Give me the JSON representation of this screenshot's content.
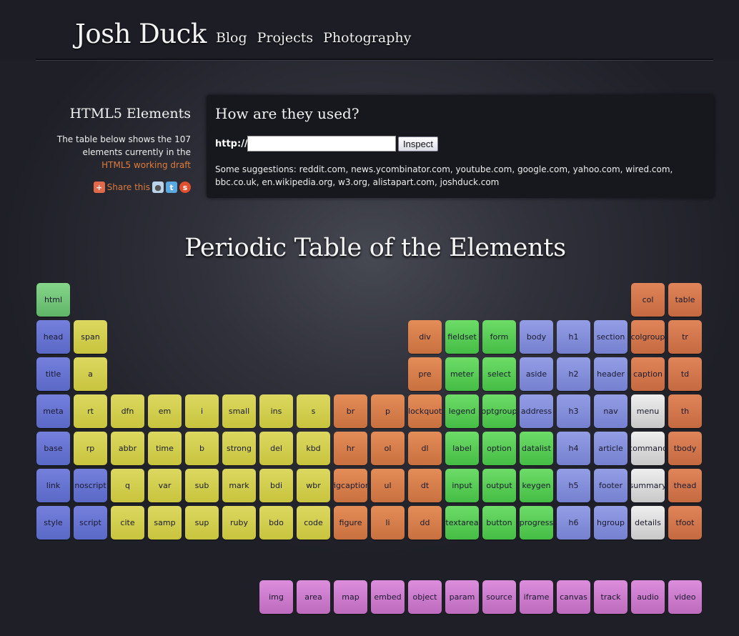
{
  "header": {
    "site_title": "Josh Duck",
    "nav": [
      "Blog",
      "Projects",
      "Photography"
    ]
  },
  "sidebar": {
    "title": "HTML5 Elements",
    "description": "The table below shows the 107 elements currently in the",
    "draft_link": "HTML5 working draft",
    "share_label": "Share this",
    "share_icons": [
      "share-plus-icon",
      "reddit-icon",
      "twitter-icon",
      "stumbleupon-icon"
    ]
  },
  "inspect": {
    "heading": "How are they used?",
    "prefix": "http://",
    "input_value": "",
    "button_label": "Inspect",
    "suggestions": "Some suggestions: reddit.com, news.ycombinator.com, youtube.com, google.com, yahoo.com, wired.com, bbc.co.uk, en.wikipedia.org, w3.org, alistapart.com, joshduck.com"
  },
  "table_title": "Periodic Table of the Elements",
  "colors": {
    "root": "#73c57a",
    "metadata": "#6874d2",
    "text_level": "#d2ce50",
    "grouping": "#d87e4c",
    "forms": "#59cd57",
    "sections": "#858fdb",
    "interactive": "#dcdcdc",
    "tables": "#d47a4e",
    "embedded": "#cd7ccd"
  },
  "elements": [
    {
      "name": "html",
      "col": 0,
      "row": 0,
      "cat": "root"
    },
    {
      "name": "head",
      "col": 0,
      "row": 1,
      "cat": "meta"
    },
    {
      "name": "title",
      "col": 0,
      "row": 2,
      "cat": "meta"
    },
    {
      "name": "meta",
      "col": 0,
      "row": 3,
      "cat": "meta"
    },
    {
      "name": "base",
      "col": 0,
      "row": 4,
      "cat": "meta"
    },
    {
      "name": "link",
      "col": 0,
      "row": 5,
      "cat": "meta"
    },
    {
      "name": "style",
      "col": 0,
      "row": 6,
      "cat": "meta"
    },
    {
      "name": "span",
      "col": 1,
      "row": 1,
      "cat": "text"
    },
    {
      "name": "a",
      "col": 1,
      "row": 2,
      "cat": "text"
    },
    {
      "name": "rt",
      "col": 1,
      "row": 3,
      "cat": "text"
    },
    {
      "name": "rp",
      "col": 1,
      "row": 4,
      "cat": "text"
    },
    {
      "name": "noscript",
      "col": 1,
      "row": 5,
      "cat": "meta"
    },
    {
      "name": "script",
      "col": 1,
      "row": 6,
      "cat": "meta"
    },
    {
      "name": "dfn",
      "col": 2,
      "row": 3,
      "cat": "text"
    },
    {
      "name": "abbr",
      "col": 2,
      "row": 4,
      "cat": "text"
    },
    {
      "name": "q",
      "col": 2,
      "row": 5,
      "cat": "text"
    },
    {
      "name": "cite",
      "col": 2,
      "row": 6,
      "cat": "text"
    },
    {
      "name": "em",
      "col": 3,
      "row": 3,
      "cat": "text"
    },
    {
      "name": "time",
      "col": 3,
      "row": 4,
      "cat": "text"
    },
    {
      "name": "var",
      "col": 3,
      "row": 5,
      "cat": "text"
    },
    {
      "name": "samp",
      "col": 3,
      "row": 6,
      "cat": "text"
    },
    {
      "name": "i",
      "col": 4,
      "row": 3,
      "cat": "text"
    },
    {
      "name": "b",
      "col": 4,
      "row": 4,
      "cat": "text"
    },
    {
      "name": "sub",
      "col": 4,
      "row": 5,
      "cat": "text"
    },
    {
      "name": "sup",
      "col": 4,
      "row": 6,
      "cat": "text"
    },
    {
      "name": "small",
      "col": 5,
      "row": 3,
      "cat": "text"
    },
    {
      "name": "strong",
      "col": 5,
      "row": 4,
      "cat": "text"
    },
    {
      "name": "mark",
      "col": 5,
      "row": 5,
      "cat": "text"
    },
    {
      "name": "ruby",
      "col": 5,
      "row": 6,
      "cat": "text"
    },
    {
      "name": "ins",
      "col": 6,
      "row": 3,
      "cat": "text"
    },
    {
      "name": "del",
      "col": 6,
      "row": 4,
      "cat": "text"
    },
    {
      "name": "bdi",
      "col": 6,
      "row": 5,
      "cat": "text"
    },
    {
      "name": "bdo",
      "col": 6,
      "row": 6,
      "cat": "text"
    },
    {
      "name": "s",
      "col": 7,
      "row": 3,
      "cat": "text"
    },
    {
      "name": "kbd",
      "col": 7,
      "row": 4,
      "cat": "text"
    },
    {
      "name": "wbr",
      "col": 7,
      "row": 5,
      "cat": "text"
    },
    {
      "name": "code",
      "col": 7,
      "row": 6,
      "cat": "text"
    },
    {
      "name": "br",
      "col": 8,
      "row": 3,
      "cat": "group"
    },
    {
      "name": "hr",
      "col": 8,
      "row": 4,
      "cat": "group"
    },
    {
      "name": "figcaption",
      "col": 8,
      "row": 5,
      "cat": "group"
    },
    {
      "name": "figure",
      "col": 8,
      "row": 6,
      "cat": "group"
    },
    {
      "name": "p",
      "col": 9,
      "row": 3,
      "cat": "group"
    },
    {
      "name": "ol",
      "col": 9,
      "row": 4,
      "cat": "group"
    },
    {
      "name": "ul",
      "col": 9,
      "row": 5,
      "cat": "group"
    },
    {
      "name": "li",
      "col": 9,
      "row": 6,
      "cat": "group"
    },
    {
      "name": "div",
      "col": 10,
      "row": 1,
      "cat": "group"
    },
    {
      "name": "pre",
      "col": 10,
      "row": 2,
      "cat": "group"
    },
    {
      "name": "blockquote",
      "col": 10,
      "row": 3,
      "cat": "group"
    },
    {
      "name": "dl",
      "col": 10,
      "row": 4,
      "cat": "group"
    },
    {
      "name": "dt",
      "col": 10,
      "row": 5,
      "cat": "group"
    },
    {
      "name": "dd",
      "col": 10,
      "row": 6,
      "cat": "group"
    },
    {
      "name": "fieldset",
      "col": 11,
      "row": 1,
      "cat": "form"
    },
    {
      "name": "meter",
      "col": 11,
      "row": 2,
      "cat": "form"
    },
    {
      "name": "legend",
      "col": 11,
      "row": 3,
      "cat": "form"
    },
    {
      "name": "label",
      "col": 11,
      "row": 4,
      "cat": "form"
    },
    {
      "name": "input",
      "col": 11,
      "row": 5,
      "cat": "form"
    },
    {
      "name": "textarea",
      "col": 11,
      "row": 6,
      "cat": "form"
    },
    {
      "name": "form",
      "col": 12,
      "row": 1,
      "cat": "form"
    },
    {
      "name": "select",
      "col": 12,
      "row": 2,
      "cat": "form"
    },
    {
      "name": "optgroup",
      "col": 12,
      "row": 3,
      "cat": "form"
    },
    {
      "name": "option",
      "col": 12,
      "row": 4,
      "cat": "form"
    },
    {
      "name": "output",
      "col": 12,
      "row": 5,
      "cat": "form"
    },
    {
      "name": "button",
      "col": 12,
      "row": 6,
      "cat": "form"
    },
    {
      "name": "body",
      "col": 13,
      "row": 1,
      "cat": "sect"
    },
    {
      "name": "aside",
      "col": 13,
      "row": 2,
      "cat": "sect"
    },
    {
      "name": "address",
      "col": 13,
      "row": 3,
      "cat": "sect"
    },
    {
      "name": "datalist",
      "col": 13,
      "row": 4,
      "cat": "form"
    },
    {
      "name": "keygen",
      "col": 13,
      "row": 5,
      "cat": "form"
    },
    {
      "name": "progress",
      "col": 13,
      "row": 6,
      "cat": "form"
    },
    {
      "name": "h1",
      "col": 14,
      "row": 1,
      "cat": "sect"
    },
    {
      "name": "h2",
      "col": 14,
      "row": 2,
      "cat": "sect"
    },
    {
      "name": "h3",
      "col": 14,
      "row": 3,
      "cat": "sect"
    },
    {
      "name": "h4",
      "col": 14,
      "row": 4,
      "cat": "sect"
    },
    {
      "name": "h5",
      "col": 14,
      "row": 5,
      "cat": "sect"
    },
    {
      "name": "h6",
      "col": 14,
      "row": 6,
      "cat": "sect"
    },
    {
      "name": "section",
      "col": 15,
      "row": 1,
      "cat": "sect"
    },
    {
      "name": "header",
      "col": 15,
      "row": 2,
      "cat": "sect"
    },
    {
      "name": "nav",
      "col": 15,
      "row": 3,
      "cat": "sect"
    },
    {
      "name": "article",
      "col": 15,
      "row": 4,
      "cat": "sect"
    },
    {
      "name": "footer",
      "col": 15,
      "row": 5,
      "cat": "sect"
    },
    {
      "name": "hgroup",
      "col": 15,
      "row": 6,
      "cat": "sect"
    },
    {
      "name": "col",
      "col": 16,
      "row": 0,
      "cat": "table"
    },
    {
      "name": "colgroup",
      "col": 16,
      "row": 1,
      "cat": "table"
    },
    {
      "name": "caption",
      "col": 16,
      "row": 2,
      "cat": "table"
    },
    {
      "name": "menu",
      "col": 16,
      "row": 3,
      "cat": "inter"
    },
    {
      "name": "command",
      "col": 16,
      "row": 4,
      "cat": "inter"
    },
    {
      "name": "summary",
      "col": 16,
      "row": 5,
      "cat": "inter"
    },
    {
      "name": "details",
      "col": 16,
      "row": 6,
      "cat": "inter"
    },
    {
      "name": "table",
      "col": 17,
      "row": 0,
      "cat": "table"
    },
    {
      "name": "tr",
      "col": 17,
      "row": 1,
      "cat": "table"
    },
    {
      "name": "td",
      "col": 17,
      "row": 2,
      "cat": "table"
    },
    {
      "name": "th",
      "col": 17,
      "row": 3,
      "cat": "table"
    },
    {
      "name": "tbody",
      "col": 17,
      "row": 4,
      "cat": "table"
    },
    {
      "name": "thead",
      "col": 17,
      "row": 5,
      "cat": "table"
    },
    {
      "name": "tfoot",
      "col": 17,
      "row": 6,
      "cat": "table"
    },
    {
      "name": "img",
      "col": 6,
      "row": 8,
      "cat": "embed"
    },
    {
      "name": "area",
      "col": 7,
      "row": 8,
      "cat": "embed"
    },
    {
      "name": "map",
      "col": 8,
      "row": 8,
      "cat": "embed"
    },
    {
      "name": "embed",
      "col": 9,
      "row": 8,
      "cat": "embed"
    },
    {
      "name": "object",
      "col": 10,
      "row": 8,
      "cat": "embed"
    },
    {
      "name": "param",
      "col": 11,
      "row": 8,
      "cat": "embed"
    },
    {
      "name": "source",
      "col": 12,
      "row": 8,
      "cat": "embed"
    },
    {
      "name": "iframe",
      "col": 13,
      "row": 8,
      "cat": "embed"
    },
    {
      "name": "canvas",
      "col": 14,
      "row": 8,
      "cat": "embed"
    },
    {
      "name": "track",
      "col": 15,
      "row": 8,
      "cat": "embed"
    },
    {
      "name": "audio",
      "col": 16,
      "row": 8,
      "cat": "embed"
    },
    {
      "name": "video",
      "col": 17,
      "row": 8,
      "cat": "embed"
    }
  ]
}
